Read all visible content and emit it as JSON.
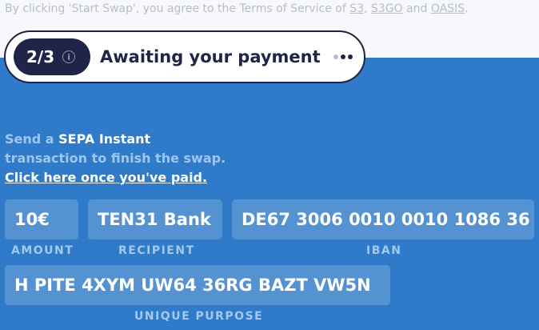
{
  "terms": {
    "prefix": "By clicking 'Start Swap', you agree to the Terms of Service of ",
    "link1": "S3",
    "sep": ", ",
    "link2": "S3GO",
    "and": " and ",
    "link3": "OASIS",
    "suffix": "."
  },
  "status": {
    "step": "2/3",
    "info_icon": "info-icon",
    "text": "Awaiting your payment",
    "indicator_icon": "loading-dots-icon"
  },
  "instructions": {
    "line1_prefix": "Send a ",
    "line1_highlight": "SEPA Instant",
    "line2": "transaction to finish the swap.",
    "paid_link": "Click here once you've paid."
  },
  "payment": {
    "amount": {
      "value": "10€",
      "label": "AMOUNT"
    },
    "recipient": {
      "value": "TEN31 Bank",
      "label": "RECIPIENT"
    },
    "iban": {
      "value": "DE67 3006 0010 0010 1086 36",
      "label": "IBAN"
    },
    "purpose": {
      "value": "H PITE 4XYM UW64 36RG BAZT VW5N",
      "label": "UNIQUE PURPOSE"
    }
  },
  "colors": {
    "background_blue": "#2f7bc9",
    "navy": "#1f2448",
    "white": "#ffffff"
  }
}
